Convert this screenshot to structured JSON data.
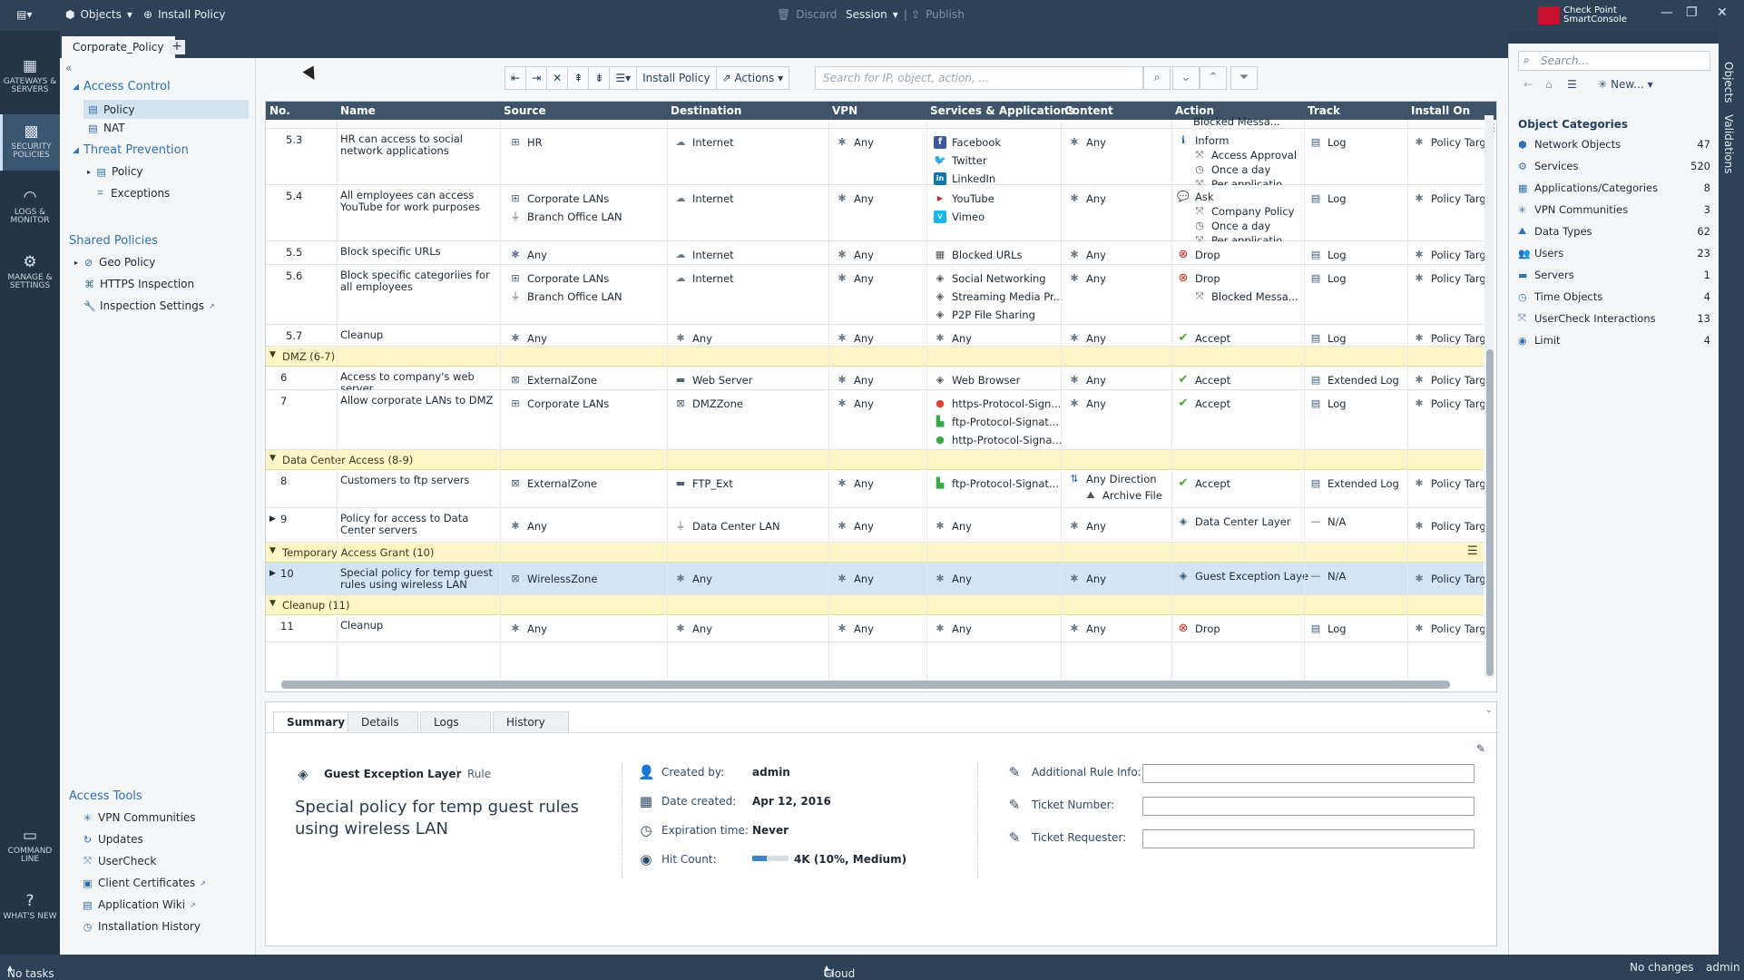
{
  "window": {
    "objects_label": "Objects",
    "install_policy_label": "Install Policy",
    "discard_label": "Discard",
    "session_label": "Session",
    "publish_label": "Publish",
    "brand_line1": "Check Point",
    "brand_line2": "SmartConsole"
  },
  "leftnav": {
    "gateways": "GATEWAYS & SERVERS",
    "security": "SECURITY POLICIES",
    "logs": "LOGS & MONITOR",
    "manage": "MANAGE & SETTINGS",
    "cmdline": "COMMAND LINE",
    "whatsnew": "WHAT'S NEW"
  },
  "tabs": {
    "active": "Corporate_Policy",
    "add": "+"
  },
  "tree": {
    "access_control": "Access Control",
    "policy": "Policy",
    "nat": "NAT",
    "threat_prevention": "Threat Prevention",
    "tp_policy": "Policy",
    "exceptions": "Exceptions",
    "shared_policies": "Shared Policies",
    "geo_policy": "Geo Policy",
    "https_inspection": "HTTPS Inspection",
    "inspection_settings": "Inspection Settings",
    "access_tools": "Access Tools",
    "vpn_communities": "VPN Communities",
    "updates": "Updates",
    "usercheck": "UserCheck",
    "client_certificates": "Client Certificates",
    "application_wiki": "Application Wiki",
    "installation_history": "Installation History"
  },
  "toolbar": {
    "install_policy": "Install Policy",
    "actions": "Actions",
    "search_placeholder": "Search for IP, object, action, ..."
  },
  "columns": [
    "No.",
    "Name",
    "Source",
    "Destination",
    "VPN",
    "Services & Applications",
    "Content",
    "Action",
    "Track",
    "Install On"
  ],
  "rows": {
    "r_top_action": "Blocked Messa...",
    "r53": {
      "no": "5.3",
      "name": "HR can access to social network applications",
      "src": "HR",
      "dst": "Internet",
      "vpn": "Any",
      "svc1": "Facebook",
      "svc2": "Twitter",
      "svc3": "LinkedIn",
      "content": "Any",
      "action": "Inform",
      "act2": "Access Approval",
      "act3": "Once a day",
      "act4": "Per applicatio...",
      "track": "Log",
      "install": "Policy Targ"
    },
    "r54": {
      "no": "5.4",
      "name": "All employees can access YouTube for work purposes",
      "src1": "Corporate LANs",
      "src2": "Branch Office LAN",
      "dst": "Internet",
      "vpn": "Any",
      "svc1": "YouTube",
      "svc2": "Vimeo",
      "content": "Any",
      "action": "Ask",
      "act2": "Company Policy",
      "act3": "Once a day",
      "act4": "Per applicatio...",
      "track": "Log",
      "install": "Policy Targ"
    },
    "r55": {
      "no": "5.5",
      "name": "Block specific URLs",
      "src": "Any",
      "dst": "Internet",
      "vpn": "Any",
      "svc1": "Blocked URLs",
      "content": "Any",
      "action": "Drop",
      "track": "Log",
      "install": "Policy Targ"
    },
    "r56": {
      "no": "5.6",
      "name": "Block specific categoriies for all employees",
      "src1": "Corporate LANs",
      "src2": "Branch Office LAN",
      "dst": "Internet",
      "vpn": "Any",
      "svc1": "Social Networking",
      "svc2": "Streaming Media Pr...",
      "svc3": "P2P File Sharing",
      "content": "Any",
      "action": "Drop",
      "act2": "Blocked Messa...",
      "track": "Log",
      "install": "Policy Targ"
    },
    "r57": {
      "no": "5.7",
      "name": "Cleanup",
      "src": "Any",
      "dst": "Any",
      "vpn": "Any",
      "svc1": "Any",
      "content": "Any",
      "action": "Accept",
      "track": "Log",
      "install": "Policy Targ"
    },
    "sec_dmz": "DMZ (6-7)",
    "r6": {
      "no": "6",
      "name": "Access to company's web server",
      "src": "ExternalZone",
      "dst": "Web Server",
      "vpn": "Any",
      "svc1": "Web Browser",
      "content": "Any",
      "action": "Accept",
      "track": "Extended Log",
      "install": "Policy Targ"
    },
    "r7": {
      "no": "7",
      "name": "Allow corporate LANs to DMZ",
      "src": "Corporate LANs",
      "dst": "DMZZone",
      "vpn": "Any",
      "svc1": "https-Protocol-Sign...",
      "svc2": "ftp-Protocol-Signat...",
      "svc3": "http-Protocol-Signa...",
      "content": "Any",
      "action": "Accept",
      "track": "Log",
      "install": "Policy Targ"
    },
    "sec_dc": "Data Center Access (8-9)",
    "r8": {
      "no": "8",
      "name": "Customers to ftp servers",
      "src": "ExternalZone",
      "dst": "FTP_Ext",
      "vpn": "Any",
      "svc1": "ftp-Protocol-Signat...",
      "content1": "Any Direction",
      "content2": "Archive File",
      "action": "Accept",
      "track": "Extended Log",
      "install": "Policy Targ"
    },
    "r9": {
      "no": "9",
      "name": "Policy for access to Data Center servers",
      "src": "Any",
      "dst": "Data Center LAN",
      "vpn": "Any",
      "svc1": "Any",
      "content": "Any",
      "action": "Data Center Layer",
      "track": "N/A",
      "install": "Policy Targ"
    },
    "sec_tmp": "Temporary Access Grant (10)",
    "r10": {
      "no": "10",
      "name": "Special policy for temp guest rules using wireless LAN",
      "src": "WirelessZone",
      "dst": "Any",
      "vpn": "Any",
      "svc1": "Any",
      "content": "Any",
      "action": "Guest Exception Laye",
      "track": "N/A",
      "install": "Policy Targ"
    },
    "sec_cleanup": "Cleanup (11)",
    "r11": {
      "no": "11",
      "name": "Cleanup",
      "src": "Any",
      "dst": "Any",
      "vpn": "Any",
      "svc1": "Any",
      "content": "Any",
      "action": "Drop",
      "track": "Log",
      "install": "Policy Targ"
    }
  },
  "summary": {
    "tabs": [
      "Summary",
      "Details",
      "Logs",
      "History"
    ],
    "layer": "Guest Exception Layer",
    "rule": "Rule",
    "title": "Special policy for temp guest rules using wireless LAN",
    "created_by_label": "Created by:",
    "created_by": "admin",
    "date_created_label": "Date created:",
    "date_created": "Apr 12, 2016",
    "expiration_label": "Expiration time:",
    "expiration": "Never",
    "hit_count_label": "Hit Count:",
    "hit_count": "4K (10%, Medium)",
    "hit_fraction": 0.1,
    "add_rule_info_label": "Additional Rule Info:",
    "ticket_number_label": "Ticket Number:",
    "ticket_requester_label": "Ticket Requester:"
  },
  "objects_panel": {
    "search_placeholder": "Search...",
    "new_label": "New...",
    "categories_title": "Object Categories",
    "categories": [
      {
        "name": "Network Objects",
        "count": "47"
      },
      {
        "name": "Services",
        "count": "520"
      },
      {
        "name": "Applications/Categories",
        "count": "8"
      },
      {
        "name": "VPN Communities",
        "count": "3"
      },
      {
        "name": "Data Types",
        "count": "62"
      },
      {
        "name": "Users",
        "count": "23"
      },
      {
        "name": "Servers",
        "count": "1"
      },
      {
        "name": "Time Objects",
        "count": "4"
      },
      {
        "name": "UserCheck Interactions",
        "count": "13"
      },
      {
        "name": "Limit",
        "count": "4"
      }
    ],
    "vtab_objects": "Objects",
    "vtab_validations": "Validations"
  },
  "status": {
    "tasks": "No tasks in progress",
    "server": "Cloud Demo Server",
    "changes": "No changes",
    "user": "admin"
  }
}
